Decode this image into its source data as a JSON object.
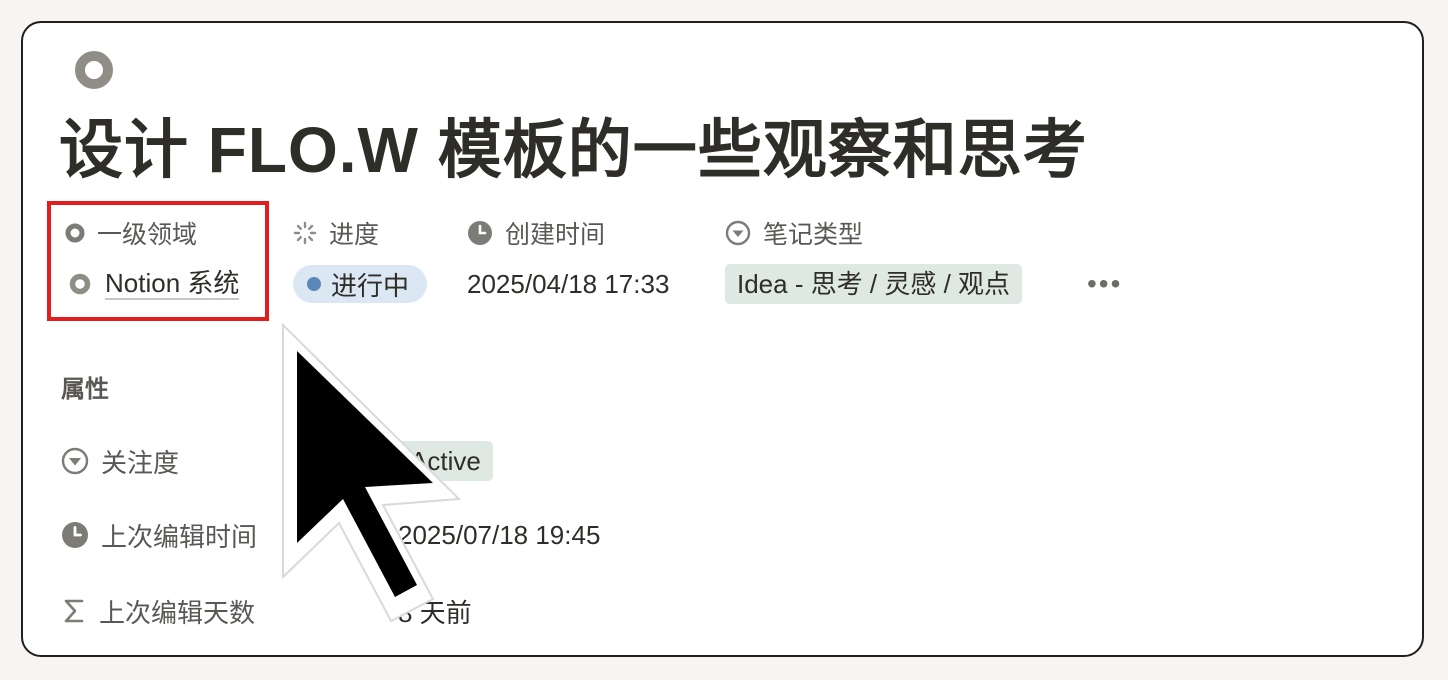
{
  "page": {
    "icon": "circle-ring-icon",
    "title": "设计 FLO.W 模板的一些观察和思考"
  },
  "header_properties": [
    {
      "label": "一级领域",
      "icon": "circle-ring-icon"
    },
    {
      "label": "进度",
      "icon": "progress-spinner-icon"
    },
    {
      "label": "创建时间",
      "icon": "clock-icon"
    },
    {
      "label": "笔记类型",
      "icon": "dropdown-circle-icon"
    }
  ],
  "header_values": {
    "domain": "Notion 系统",
    "status": "进行中",
    "created": "2025/04/18 17:33",
    "note_type": "Idea - 思考 / 灵感 / 观点",
    "more": "•••"
  },
  "attributes": {
    "section_label": "属性",
    "rows": [
      {
        "label": "关注度",
        "icon": "dropdown-circle-icon",
        "value": "Active"
      },
      {
        "label": "上次编辑时间",
        "icon": "clock-icon",
        "value": "2025/07/18 19:45"
      },
      {
        "label": "上次编辑天数",
        "icon": "sigma-icon",
        "value": "8 天前"
      }
    ]
  },
  "colors": {
    "highlight": "#e11d1d",
    "status_bg": "#dbe7f3",
    "status_dot": "#5b88b8",
    "tag_bg": "#dfe9e3"
  }
}
